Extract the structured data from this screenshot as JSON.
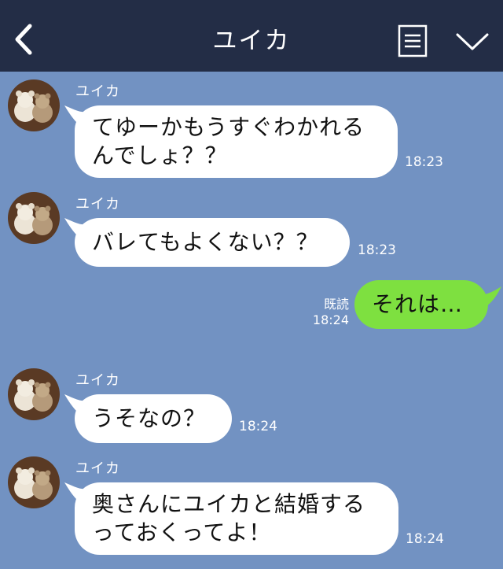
{
  "header": {
    "title": "ユイカ",
    "back_icon": "chevron-left-icon",
    "menu_icon": "menu-icon",
    "collapse_icon": "chevron-down-icon"
  },
  "colors": {
    "chat_background": "#7292c2",
    "header_background": "#232d46",
    "incoming_bubble": "#ffffff",
    "outgoing_bubble": "#7ee040"
  },
  "messages": [
    {
      "sender": "ユイカ",
      "line1": "てゆーかもうすぐわかれる",
      "line2": "んでしょ？？",
      "time": "18:23"
    },
    {
      "sender": "ユイカ",
      "line1": "バレてもよくない？？",
      "time": "18:23"
    },
    {
      "sender": "me",
      "line1": "それは…",
      "read": "既読",
      "time": "18:24"
    },
    {
      "sender": "ユイカ",
      "line1": "うそなの？",
      "time": "18:24"
    },
    {
      "sender": "ユイカ",
      "line1": "奥さんにユイカと結婚する",
      "line2": "っておくってよ！",
      "time": "18:24"
    }
  ]
}
